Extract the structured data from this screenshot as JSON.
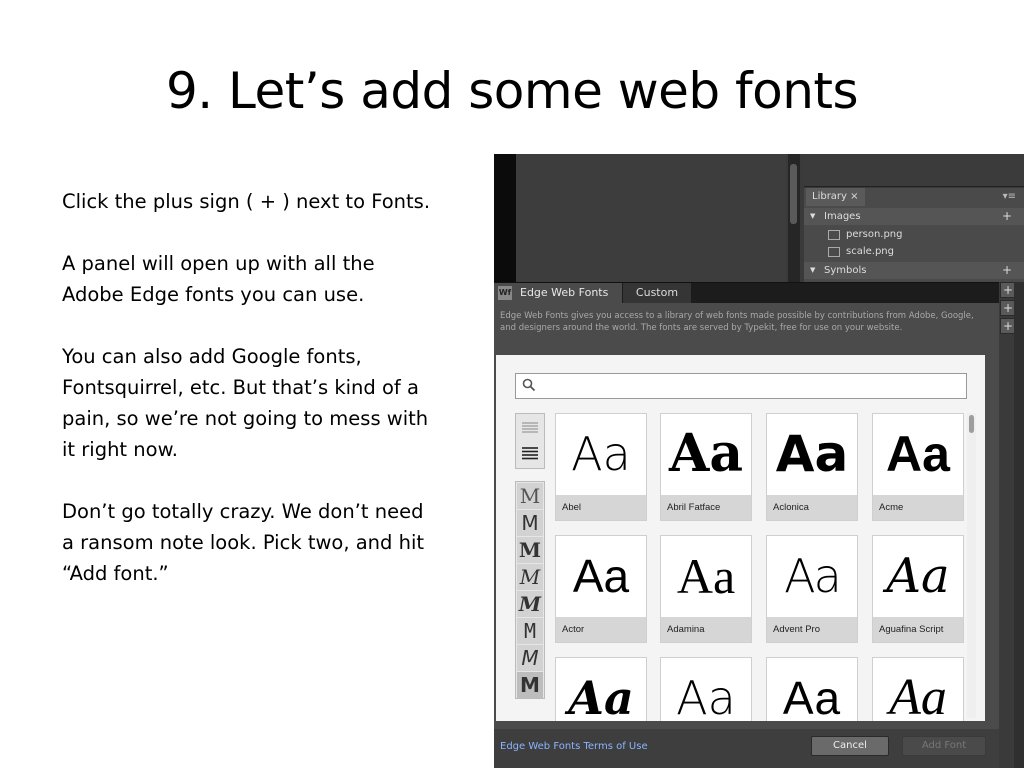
{
  "slide": {
    "title": "9. Let’s add some web fonts",
    "paragraphs": [
      "Click the plus sign ( + ) next to Fonts.",
      "A panel will open up with all the Adobe Edge fonts you can use.",
      "You can also add Google fonts, Fontsquirrel, etc. But that’s kind of a pain, so we’re not going to mess with it right now.",
      "Don’t go totally crazy. We don’t need a ransom note look. Pick two, and hit “Add font.”"
    ]
  },
  "library": {
    "tab_label": "Library ×",
    "menu_glyph": "▾≡",
    "images_label": "Images",
    "files": [
      "person.png",
      "scale.png"
    ],
    "symbols_label": "Symbols",
    "plus": "+"
  },
  "dialog": {
    "icon_label": "Wf",
    "tabs": [
      "Edge Web Fonts",
      "Custom"
    ],
    "description": "Edge Web Fonts gives you access to a library of web fonts made possible by contributions from Adobe, Google, and designers around the world. The fonts are served by Typekit, free for use on your website.",
    "search_placeholder": "",
    "sample_text": "Aa",
    "style_glyph": "M",
    "fonts": [
      "Abel",
      "Abril Fatface",
      "Aclonica",
      "Acme",
      "Actor",
      "Adamina",
      "Advent Pro",
      "Aguafina Script",
      "",
      "",
      "",
      ""
    ],
    "terms_link": "Edge Web Fonts Terms of Use",
    "cancel_label": "Cancel",
    "add_font_label": "Add Font"
  },
  "colors": {
    "panel_bg": "#4b4b4b",
    "link": "#8ab4ff",
    "disabled_text": "#777777"
  }
}
